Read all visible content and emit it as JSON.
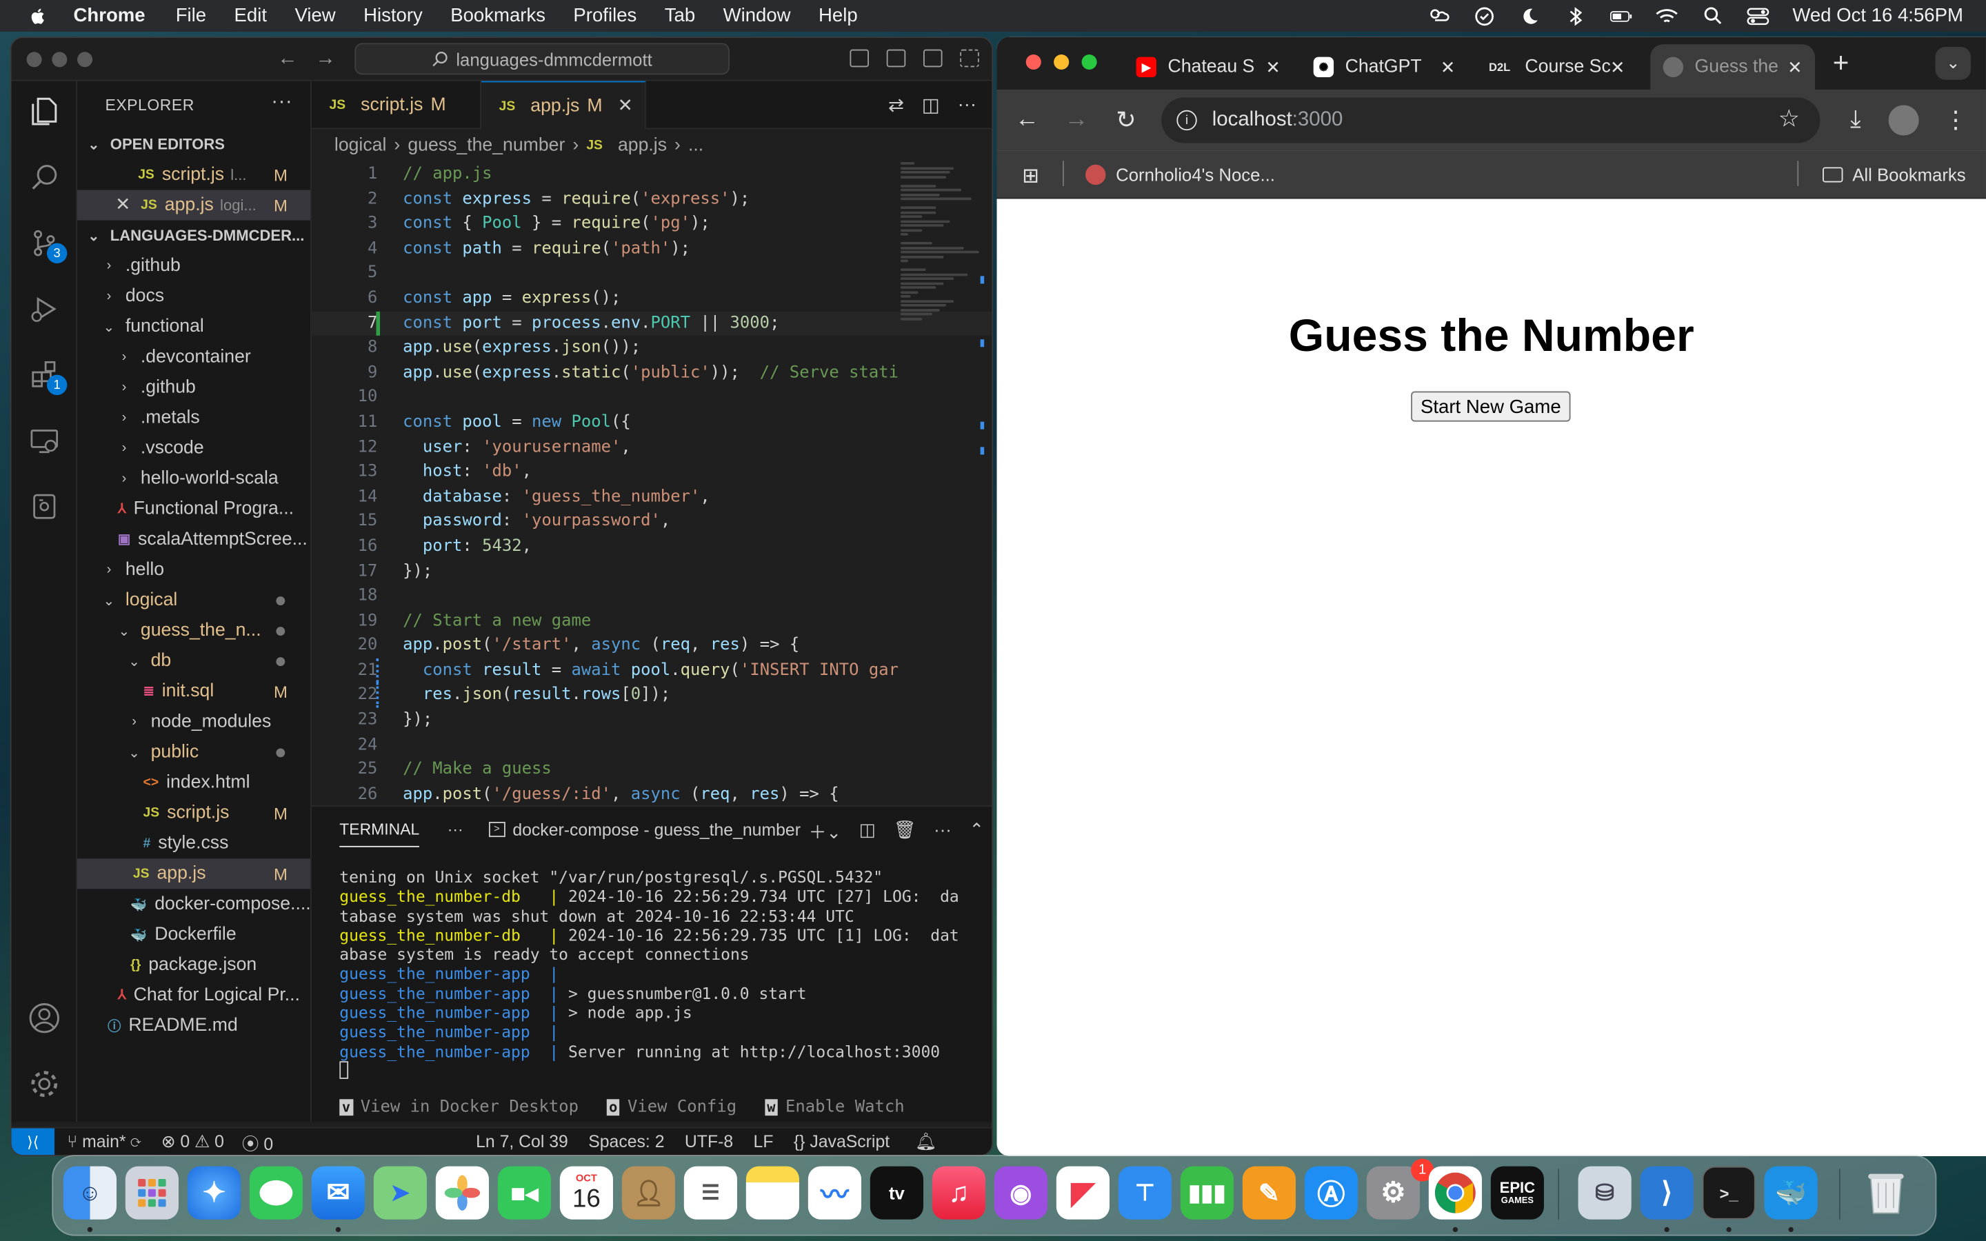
{
  "menubar": {
    "app_name": "Chrome",
    "items": [
      "File",
      "Edit",
      "View",
      "History",
      "Bookmarks",
      "Profiles",
      "Tab",
      "Window",
      "Help"
    ],
    "clock": "Wed Oct 16  4:56PM"
  },
  "vscode": {
    "search_text": "languages-dmmcdermott",
    "explorer_title": "EXPLORER",
    "open_editors_label": "OPEN EDITORS",
    "open_editors": [
      {
        "name": "script.js",
        "hint": "l...",
        "flag": "M"
      },
      {
        "name": "app.js",
        "hint": "logi...",
        "flag": "M"
      }
    ],
    "workspace_label": "LANGUAGES-DMMCDER...",
    "tree": [
      {
        "label": ".github"
      },
      {
        "label": "docs"
      },
      {
        "label": "functional"
      },
      {
        "label": ".devcontainer"
      },
      {
        "label": ".github"
      },
      {
        "label": ".metals"
      },
      {
        "label": ".vscode"
      },
      {
        "label": "hello-world-scala"
      },
      {
        "label": "Functional Progra..."
      },
      {
        "label": "scalaAttemptScree..."
      },
      {
        "label": "hello"
      },
      {
        "label": "logical"
      },
      {
        "label": "guess_the_n..."
      },
      {
        "label": "db"
      },
      {
        "label": "init.sql",
        "flag": "M"
      },
      {
        "label": "node_modules"
      },
      {
        "label": "public"
      },
      {
        "label": "index.html"
      },
      {
        "label": "script.js",
        "flag": "M"
      },
      {
        "label": "style.css"
      },
      {
        "label": "app.js",
        "flag": "M"
      },
      {
        "label": "docker-compose...."
      },
      {
        "label": "Dockerfile"
      },
      {
        "label": "package.json"
      },
      {
        "label": "Chat for Logical Pr..."
      },
      {
        "label": "README.md"
      }
    ],
    "tabs": [
      {
        "label": "script.js",
        "flag": "M"
      },
      {
        "label": "app.js",
        "flag": "M"
      }
    ],
    "breadcrumb": [
      "logical",
      "guess_the_number",
      "app.js",
      "..."
    ],
    "code_lines": [
      "// app.js",
      "const express = require('express');",
      "const { Pool } = require('pg');",
      "const path = require('path');",
      "",
      "const app = express();",
      "const port = process.env.PORT || 3000;",
      "app.use(express.json());",
      "app.use(express.static('public'));  // Serve stati",
      "",
      "const pool = new Pool({",
      "  user: 'yourusername',",
      "  host: 'db',",
      "  database: 'guess_the_number',",
      "  password: 'yourpassword',",
      "  port: 5432,",
      "});",
      "",
      "// Start a new game",
      "app.post('/start', async (req, res) => {",
      "  const result = await pool.query('INSERT INTO gar",
      "  res.json(result.rows[0]);",
      "});",
      "",
      "// Make a guess",
      "app.post('/guess/:id', async (req, res) => {"
    ],
    "terminal": {
      "tab_label": "TERMINAL",
      "terminal_name": "docker-compose - guess_the_number",
      "lines": [
        {
          "prefix": "",
          "text": "tening on Unix socket \"/var/run/postgresql/.s.PGSQL.5432\""
        },
        {
          "prefix": "guess_the_number-db",
          "sep": "   | ",
          "text": "2024-10-16 22:56:29.734 UTC [27] LOG:  da"
        },
        {
          "prefix": "",
          "text": "tabase system was shut down at 2024-10-16 22:53:44 UTC"
        },
        {
          "prefix": "guess_the_number-db",
          "sep": "   | ",
          "text": "2024-10-16 22:56:29.735 UTC [1] LOG:  dat"
        },
        {
          "prefix": "",
          "text": "abase system is ready to accept connections"
        },
        {
          "prefix": "guess_the_number-app",
          "sep": "  | ",
          "text": ""
        },
        {
          "prefix": "guess_the_number-app",
          "sep": "  | ",
          "text": "> guessnumber@1.0.0 start"
        },
        {
          "prefix": "guess_the_number-app",
          "sep": "  | ",
          "text": "> node app.js"
        },
        {
          "prefix": "guess_the_number-app",
          "sep": "  | ",
          "text": ""
        },
        {
          "prefix": "guess_the_number-app",
          "sep": "  | ",
          "text": "Server running at http://localhost:3000"
        }
      ],
      "links": [
        {
          "key": "v",
          "label": "View in Docker Desktop"
        },
        {
          "key": "o",
          "label": "View Config"
        },
        {
          "key": "w",
          "label": "Enable Watch"
        }
      ]
    },
    "status": {
      "branch": "main*",
      "errors": "0",
      "warnings": "0",
      "ports": "0",
      "position": "Ln 7, Col 39",
      "spaces": "Spaces: 2",
      "encoding": "UTF-8",
      "eol": "LF",
      "language": "JavaScript"
    },
    "badges": {
      "scm": "3",
      "extensions": "1"
    }
  },
  "chrome": {
    "tabs": [
      {
        "label": "Chateau S",
        "favicon": "youtube-icon"
      },
      {
        "label": "ChatGPT",
        "favicon": "chatgpt-icon"
      },
      {
        "label": "Course Sc",
        "favicon": "d2l-icon"
      },
      {
        "label": "Guess the",
        "favicon": "globe-icon"
      }
    ],
    "d2l_favicon_text": "D2L",
    "url_host": "localhost",
    "url_port": ":3000",
    "bookmark": "Cornholio4's Noce...",
    "all_bookmarks": "All Bookmarks",
    "page": {
      "title": "Guess the Number",
      "button": "Start New Game"
    }
  },
  "dock": {
    "calendar_month": "OCT",
    "calendar_day": "16",
    "settings_badge": "1",
    "epic_text": "EPIC",
    "epic_subtext": "GAMES",
    "appletv_text": "tv"
  },
  "colors": {
    "vscode_accent": "#0078d4",
    "modified": "#e2c08d",
    "terminal_db": "#e5e510",
    "terminal_app": "#3b8eea"
  }
}
